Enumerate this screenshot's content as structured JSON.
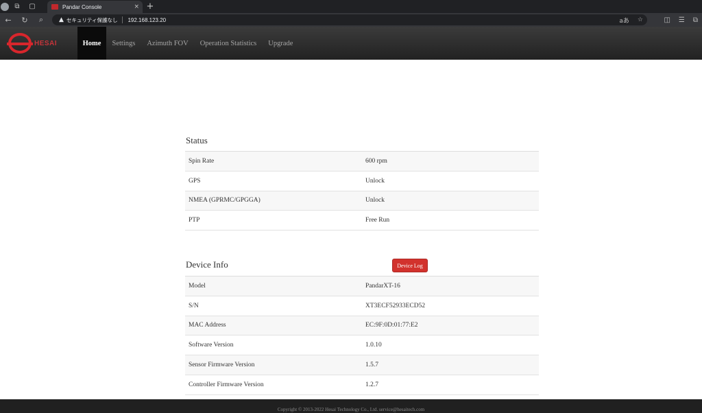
{
  "browser": {
    "tab_title": "Pandar Console",
    "tab_close": "×",
    "new_tab": "+",
    "security_text": "セキュリティ保護なし",
    "url": "192.168.123.20",
    "read_aloud": "aあ"
  },
  "nav": {
    "logo_text": "HESAI",
    "items": [
      "Home",
      "Settings",
      "Azimuth FOV",
      "Operation Statistics",
      "Upgrade"
    ],
    "active": "Home"
  },
  "status": {
    "title": "Status",
    "rows": [
      {
        "label": "Spin Rate",
        "value": "600 rpm"
      },
      {
        "label": "GPS",
        "value": "Unlock"
      },
      {
        "label": "NMEA (GPRMC/GPGGA)",
        "value": "Unlock"
      },
      {
        "label": "PTP",
        "value": "Free Run"
      }
    ]
  },
  "device_info": {
    "title": "Device Info",
    "log_button": "Device Log",
    "rows": [
      {
        "label": "Model",
        "value": "PandarXT-16"
      },
      {
        "label": "S/N",
        "value": "XT3ECF52933ECD52"
      },
      {
        "label": "MAC Address",
        "value": "EC:9F:0D:01:77:E2"
      },
      {
        "label": "Software Version",
        "value": "1.0.10"
      },
      {
        "label": "Sensor Firmware Version",
        "value": "1.5.7"
      },
      {
        "label": "Controller Firmware Version",
        "value": "1.2.7"
      }
    ]
  },
  "footer": {
    "text": "Copyright © 2013-2022 Hesai Technology Co., Ltd. service@hesaitech.com"
  },
  "colors": {
    "accent_red": "#d2322d",
    "nav_bg": "#2b2b2b",
    "nav_active": "#0b0b0b"
  }
}
